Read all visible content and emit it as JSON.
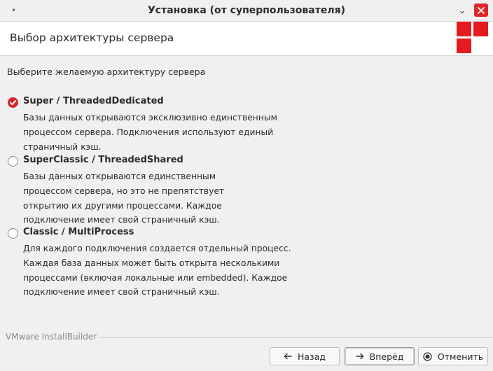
{
  "window": {
    "title": "Установка (от суперпользователя)",
    "menu_glyph": "•",
    "minimize_glyph": "⌄"
  },
  "header": {
    "title": "Выбор архитектуры сервера"
  },
  "content": {
    "instruction": "Выберите желаемую архитектуру сервера",
    "options": [
      {
        "label": "Super / ThreadedDedicated",
        "checked": true,
        "desc_lines": [
          "Базы данных открываются эксклюзивно единственным",
          "процессом сервера. Подключения используют единый",
          "страничный кэш."
        ]
      },
      {
        "label": "SuperClassic / ThreadedShared",
        "checked": false,
        "desc_lines": [
          "Базы данных открываются единственным",
          "процессом сервера, но это не препятствует",
          "открытию их другими процессами. Каждое",
          "подключение имеет свой страничный кэш."
        ]
      },
      {
        "label": "Classic / MultiProcess",
        "checked": false,
        "desc_lines": [
          "Для каждого подключения создается отдельный процесс.",
          "Каждая база данных может быть открыта несколькими",
          "процессами (включая локальные или embedded). Каждое",
          "подключение имеет свой страничный кэш."
        ]
      }
    ]
  },
  "footer": {
    "brand": "VMware InstallBuilder",
    "back_label": "Назад",
    "next_label": "Вперёд",
    "cancel_label": "Отменить"
  },
  "colors": {
    "accent": "#e51c1f",
    "close_button": "#e0262a"
  }
}
